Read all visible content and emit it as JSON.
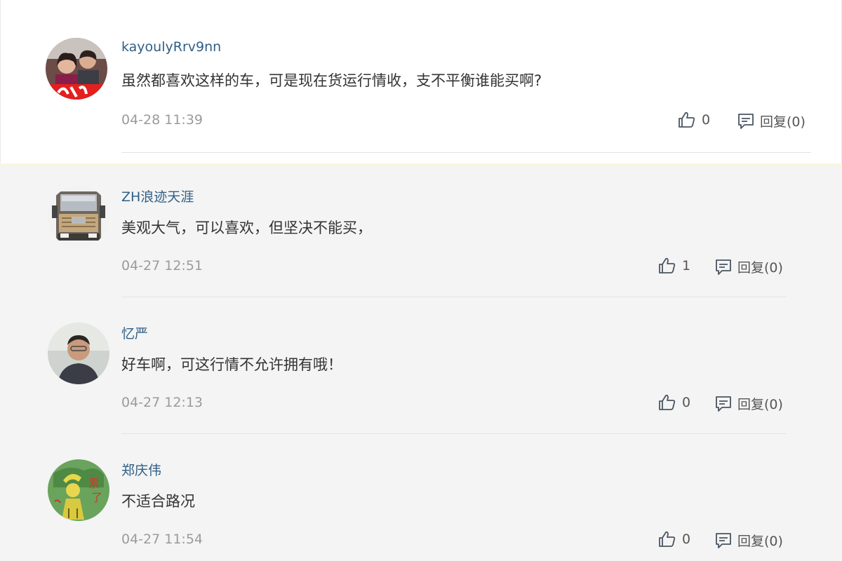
{
  "comments": [
    {
      "username": "kayoulyRrv9nn",
      "text": "虽然都喜欢这样的车，可是现在货运行情收，支不平衡谁能买啊?",
      "time": "04-28 11:39",
      "likes": "0",
      "reply_label": "回复(0)",
      "avatar_name": "avatar-photo-couple"
    },
    {
      "username": "ZH浪迹天涯",
      "text": "美观大气，可以喜欢，但坚决不能买，",
      "time": "04-27 12:51",
      "likes": "1",
      "reply_label": "回复(0)",
      "avatar_name": "avatar-truck"
    },
    {
      "username": "忆严",
      "text": "好车啊，可这行情不允许拥有哦！",
      "time": "04-27 12:13",
      "likes": "0",
      "reply_label": "回复(0)",
      "avatar_name": "avatar-photo-man"
    },
    {
      "username": "郑庆伟",
      "text": "不适合路况",
      "time": "04-27 11:54",
      "likes": "0",
      "reply_label": "回复(0)",
      "avatar_name": "avatar-cartoon"
    }
  ],
  "icons": {
    "like": "thumbs-up-icon",
    "reply": "comment-icon"
  },
  "colors": {
    "username": "#2f5f86",
    "text": "#333333",
    "time": "#9b9b9b",
    "highlight_bg": "#ffffff",
    "list_bg": "#f4f4f4"
  }
}
